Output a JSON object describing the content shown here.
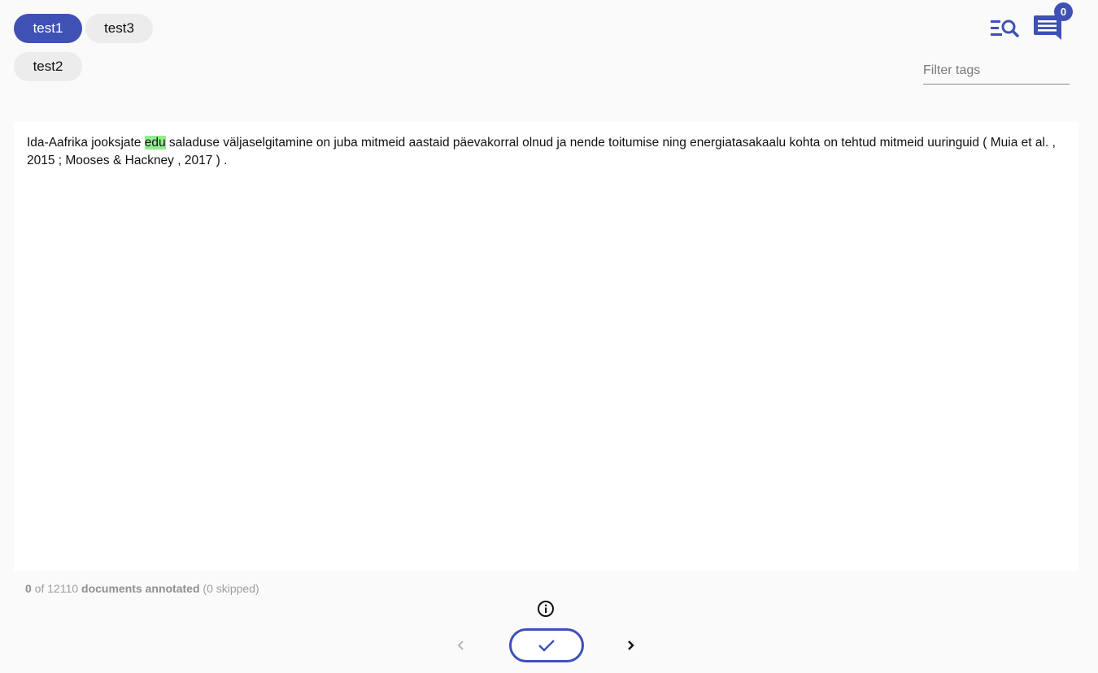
{
  "tags": [
    {
      "label": "test1",
      "selected": true
    },
    {
      "label": "test3",
      "selected": false
    },
    {
      "label": "test2",
      "selected": false
    }
  ],
  "toolbar": {
    "search_icon": "list-search-icon",
    "comments_icon": "comment-icon",
    "comment_count": "0"
  },
  "filter": {
    "placeholder": "Filter tags",
    "value": ""
  },
  "document": {
    "text_before": "Ida-Aafrika jooksjate ",
    "highlighted": "edu",
    "text_after": " saladuse väljaselgitamine on juba mitmeid aastaid päevakorral olnud ja nende toitumise ning energiatasakaalu kohta on tehtud mitmeid uuringuid ( Muia et al. , 2015 ; Mooses & Hackney , 2017 ) .",
    "highlight_color": "#90ee90"
  },
  "progress": {
    "annotated": "0",
    "of_text": " of 12110 ",
    "label": "documents annotated",
    "skipped": " (0 skipped)"
  },
  "navigation": {
    "info_icon": "info-icon",
    "prev_icon": "chevron-left-icon",
    "accept_icon": "check-icon",
    "next_icon": "chevron-right-icon"
  },
  "colors": {
    "accent": "#3f51b5",
    "chip_bg": "#ececec",
    "page_bg": "#fafafa"
  }
}
